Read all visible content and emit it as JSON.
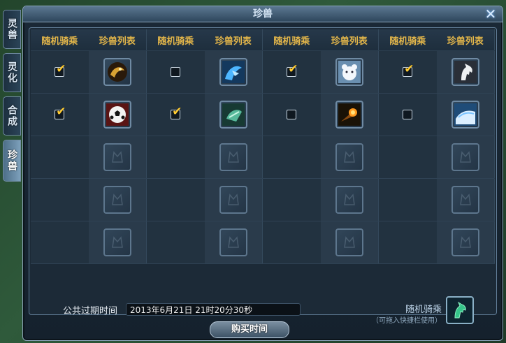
{
  "window": {
    "title": "珍兽",
    "close_icon": "close-icon"
  },
  "side_tabs": [
    {
      "label": "灵兽",
      "active": false
    },
    {
      "label": "灵化",
      "active": false
    },
    {
      "label": "合成",
      "active": false
    },
    {
      "label": "珍兽",
      "active": true
    }
  ],
  "table": {
    "headers": [
      "随机骑乘",
      "珍兽列表",
      "随机骑乘",
      "珍兽列表",
      "随机骑乘",
      "珍兽列表",
      "随机骑乘",
      "珍兽列表"
    ],
    "rows": [
      [
        {
          "checked": true,
          "pet": "golden-dragon-icon"
        },
        {
          "checked": false,
          "pet": "blue-dragon-icon"
        },
        {
          "checked": true,
          "pet": "polar-bear-icon"
        },
        {
          "checked": true,
          "pet": "white-horse-icon"
        }
      ],
      [
        {
          "checked": true,
          "pet": "soccer-ball-icon"
        },
        {
          "checked": true,
          "pet": "green-crystal-icon"
        },
        {
          "checked": false,
          "pet": "fire-comet-icon"
        },
        {
          "checked": false,
          "pet": "ice-wave-icon"
        }
      ],
      [
        {
          "checked": null,
          "pet": "empty-slot-icon"
        },
        {
          "checked": null,
          "pet": "empty-slot-icon"
        },
        {
          "checked": null,
          "pet": "empty-slot-icon"
        },
        {
          "checked": null,
          "pet": "empty-slot-icon"
        }
      ],
      [
        {
          "checked": null,
          "pet": "empty-slot-icon"
        },
        {
          "checked": null,
          "pet": "empty-slot-icon"
        },
        {
          "checked": null,
          "pet": "empty-slot-icon"
        },
        {
          "checked": null,
          "pet": "empty-slot-icon"
        }
      ],
      [
        {
          "checked": null,
          "pet": "empty-slot-icon"
        },
        {
          "checked": null,
          "pet": "empty-slot-icon"
        },
        {
          "checked": null,
          "pet": "empty-slot-icon"
        },
        {
          "checked": null,
          "pet": "empty-slot-icon"
        }
      ]
    ]
  },
  "footer": {
    "time_label": "公共过期时间",
    "time_value": "2013年6月21日 21时20分30秒",
    "random_ride_label": "随机骑乘",
    "random_ride_hint": "（可拖入快捷栏使用）",
    "random_ride_icon": "green-horse-icon",
    "buy_button": "购买时间"
  },
  "colors": {
    "header_gold": "#e3b64a",
    "check_yellow": "#ffcc33",
    "panel_bg": "#1c2a37"
  }
}
